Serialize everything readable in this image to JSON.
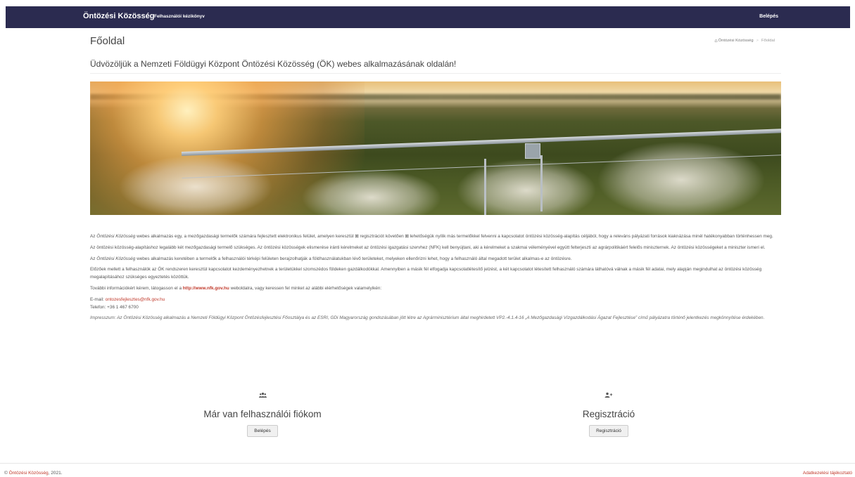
{
  "nav": {
    "brand": "Öntözési Közösség",
    "manual": "Felhasználói kézikönyv",
    "login": "Belépés"
  },
  "page": {
    "title": "Főoldal",
    "breadcrumb": {
      "home": "Öntözési Közösség",
      "current": "Főoldal"
    },
    "welcome": "Üdvözöljük a Nemzeti Földügyi Központ Öntözési Közösség (ÖK) webes alkalmazásának oldalán!"
  },
  "content": {
    "p1_em": "Öntözési Közösség",
    "p1_pre": "Az ",
    "p1_rest": " webes alkalmazás egy, a mezőgazdasági termelők számára fejlesztett elektronikus felület, amelyen keresztül ⊠ regisztrációt követően ⊠ lehetőségük nyílik más termelőkkel felvenni a kapcsolatot öntözési közösség-alapítás céljából, hogy a releváns pályázati források kiaknázása minél hatékonyabban történhessen meg.",
    "p2": "Az öntözési közösség-alapításhoz legalább két mezőgazdasági termelő szükséges. Az öntözési közösségek elismerése iránti kérelmeket az öntözési igazgatási szervhez (NFK) kell benyújtani, aki a kérelmeket a szakmai véleményével együtt felterjeszti az agrárpolitikáért felelős miniszternek. Az öntözési közösségeket a miniszter ismeri el.",
    "p3_pre": "Az ",
    "p3_em": "Öntözési Közösség",
    "p3_rest": " webes alkalmazás keretében a termelők a felhasználói térképi felületen berajzolhatják a földhasználatukban lévő területeket, melyeken ellenőrizni lehet, hogy a felhasználó által megadott terület alkalmas-e az öntözésre.",
    "p4": "Előzőek mellett a felhasználók az ÖK rendszeren keresztül kapcsolatot kezdeményezhetnek a területükkel szomszédos földeken gazdálkodókkal. Amennyiben a másik fél elfogadja kapcsolatlétesítő jelzést, a két kapcsolatot létesített felhasználó számára láthatóvá válnak a másik fél adatai, mely alapján megindulhat az öntözési közösség megalapításához szükséges egyeztetés közöttük.",
    "p5_pre": "További információkért kérem, látogasson el a ",
    "p5_link": "http://www.nfk.gov.hu",
    "p5_post": " weboldalra, vagy keressen fel minket az alábbi elérhetőségek valamelyikén:",
    "email_label": "E-mail: ",
    "email": "ontozesfejlesztes@nfk.gov.hu",
    "phone": "Telefon: +36 1 467 6700",
    "impressum": "Impresszum: Az Öntözési Közösség alkalmazás a Nemzeti Földügyi Központ Öntözésfejlesztési Főosztálya és az ESRI, GDi Magyarország gondozásában jött létre az Agrárminisztérium által meghirdetett VP2.-4.1.4-16 „A Mezőgazdasági Vízgazdálkodási Ágazat Fejlesztése” című pályázatra történő jelentkezés megkönnyítése érdekében."
  },
  "account": {
    "heading": "Már van felhasználói fiókom",
    "button": "Belépés",
    "icon": "users-icon"
  },
  "register": {
    "heading": "Regisztráció",
    "button": "Regisztráció",
    "icon": "user-plus-icon"
  },
  "footer": {
    "copyright_pre": "© ",
    "copyright_link": "Öntözési Közösség",
    "copyright_post": ", 2021.",
    "privacy": "Adatkezelési tájékoztató"
  },
  "colors": {
    "navbar": "#2b2b50",
    "link": "#c0392b"
  }
}
